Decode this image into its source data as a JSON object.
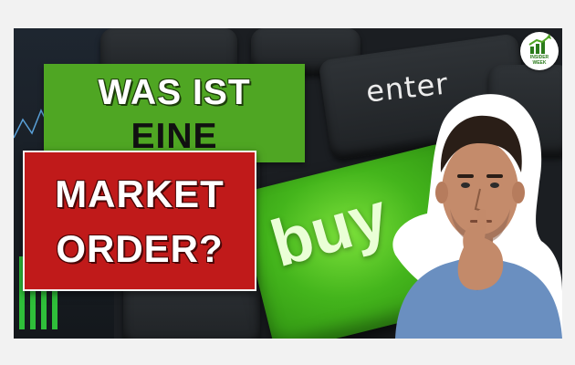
{
  "title": {
    "line1": "WAS IST",
    "line2": "EINE",
    "line3": "MARKET",
    "line4": "ORDER?"
  },
  "keyboard": {
    "enter_key_label": "enter",
    "buy_key_label": "buy"
  },
  "logo": {
    "line1": "INSIDER",
    "line2": "WEEK"
  },
  "colors": {
    "green_banner": "#4fa623",
    "red_banner": "#c01a1a",
    "buy_key": "#44b51c"
  }
}
